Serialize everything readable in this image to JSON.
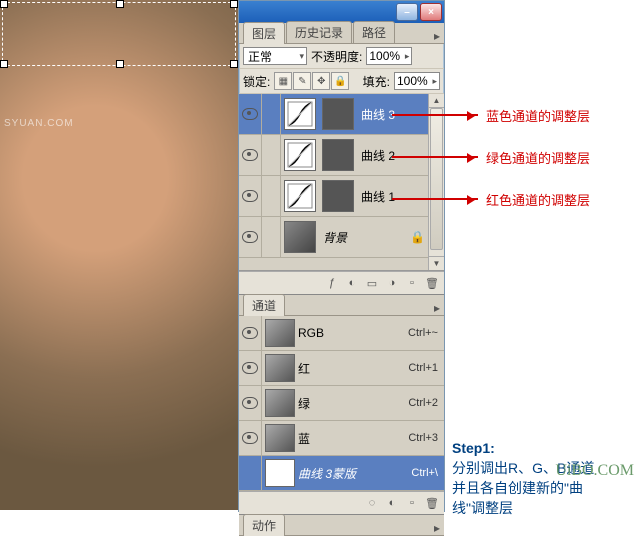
{
  "photo": {
    "watermark": "SYUAN.COM"
  },
  "panel": {
    "tabs": {
      "layers": "图层",
      "history": "历史记录",
      "paths": "路径"
    },
    "blend": {
      "mode": "正常",
      "opacity_label": "不透明度:",
      "opacity": "100%"
    },
    "lock": {
      "label": "锁定:",
      "fill_label": "填充:",
      "fill": "100%"
    }
  },
  "layers": {
    "curve3": "曲线 3",
    "curve2": "曲线 2",
    "curve1": "曲线 1",
    "background": "背景"
  },
  "channels": {
    "tab": "通道",
    "rgb": {
      "name": "RGB",
      "shortcut": "Ctrl+~"
    },
    "red": {
      "name": "红",
      "shortcut": "Ctrl+1"
    },
    "green": {
      "name": "绿",
      "shortcut": "Ctrl+2"
    },
    "blue": {
      "name": "蓝",
      "shortcut": "Ctrl+3"
    },
    "mask": {
      "name": "曲线 3蒙版",
      "shortcut": "Ctrl+\\"
    }
  },
  "actions": {
    "tab": "动作"
  },
  "annotations": {
    "blue": "蓝色通道的调整层",
    "green": "绿色通道的调整层",
    "red": "红色通道的调整层",
    "step_title": "Step1:",
    "step_line1": "分别调出R、G、B通道",
    "step_line2": "并且各自创建新的\"曲",
    "step_line3": "线\"调整层",
    "watermark": "UiBO.COM"
  }
}
